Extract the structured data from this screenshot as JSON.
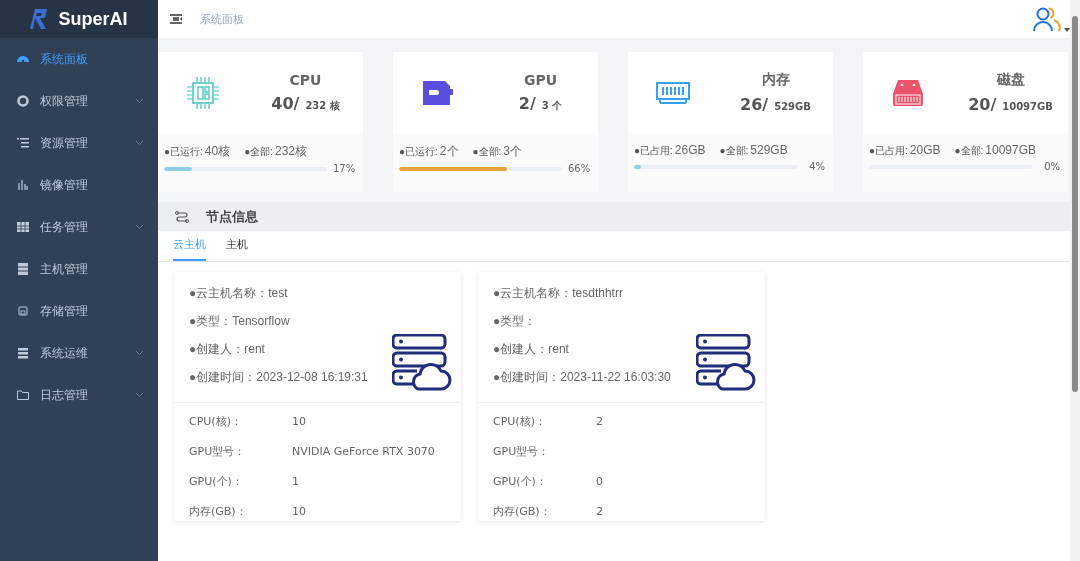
{
  "brand": {
    "name": "SuperAI"
  },
  "sidebar": {
    "items": [
      {
        "label": "系统面板",
        "selected": true,
        "has_submenu": false
      },
      {
        "label": "权限管理",
        "selected": false,
        "has_submenu": true
      },
      {
        "label": "资源管理",
        "selected": false,
        "has_submenu": true
      },
      {
        "label": "镜像管理",
        "selected": false,
        "has_submenu": false
      },
      {
        "label": "任务管理",
        "selected": false,
        "has_submenu": true
      },
      {
        "label": "主机管理",
        "selected": false,
        "has_submenu": false
      },
      {
        "label": "存储管理",
        "selected": false,
        "has_submenu": false
      },
      {
        "label": "系统运维",
        "selected": false,
        "has_submenu": true
      },
      {
        "label": "日志管理",
        "selected": false,
        "has_submenu": true
      }
    ]
  },
  "header": {
    "breadcrumb": "系统面板"
  },
  "stats": [
    {
      "kind": "cpu",
      "title": "CPU",
      "used": "40/",
      "total": "232 核",
      "left_label": "●已运行:",
      "left_value": "40核",
      "right_label": "●全部:",
      "right_value": "232核",
      "level": 0.17,
      "percent": "17%",
      "color": "#8ecde6"
    },
    {
      "kind": "gpu",
      "title": "GPU",
      "used": "2/",
      "total": "3 个",
      "left_label": "●已运行:",
      "left_value": "2个",
      "right_label": "●全部:",
      "right_value": "3个",
      "level": 0.66,
      "percent": "66%",
      "color": "#e6a23c"
    },
    {
      "kind": "memory",
      "title": "内存",
      "used": "26/",
      "total": "529GB",
      "left_label": "●已占用:",
      "left_value": "26GB",
      "right_label": "●全部:",
      "right_value": "529GB",
      "level": 0.04,
      "percent": "4%",
      "color": "#8ecde6"
    },
    {
      "kind": "disk",
      "title": "磁盘",
      "used": "20/",
      "total": "10097GB",
      "left_label": "●已占用:",
      "left_value": "20GB",
      "right_label": "●全部:",
      "right_value": "10097GB",
      "percent": "0%"
    }
  ],
  "section": {
    "title": "节点信息"
  },
  "tabs": [
    {
      "label": "云主机",
      "selected": true
    },
    {
      "label": "主机",
      "selected": false
    }
  ],
  "nodes": [
    {
      "info": [
        "●云主机名称：test",
        "●类型：Tensorflow",
        "●创建人：rent",
        "●创建时间：2023-12-08 16:19:31"
      ],
      "specs": [
        {
          "label": "CPU(核)：",
          "value": "10"
        },
        {
          "label": "GPU型号：",
          "value": "NVIDIA GeForce RTX 3070"
        },
        {
          "label": "GPU(个)：",
          "value": "1"
        },
        {
          "label": "内存(GB)：",
          "value": "10"
        }
      ]
    },
    {
      "info": [
        "●云主机名称：tesdthhtrr",
        "●类型：",
        "●创建人：rent",
        "●创建时间：2023-11-22 16:03:30"
      ],
      "specs": [
        {
          "label": "CPU(核)：",
          "value": "2"
        },
        {
          "label": "GPU型号："
        },
        {
          "label": "GPU(个)：",
          "value": "0"
        },
        {
          "label": "内存(GB)：",
          "value": "2"
        }
      ]
    }
  ]
}
